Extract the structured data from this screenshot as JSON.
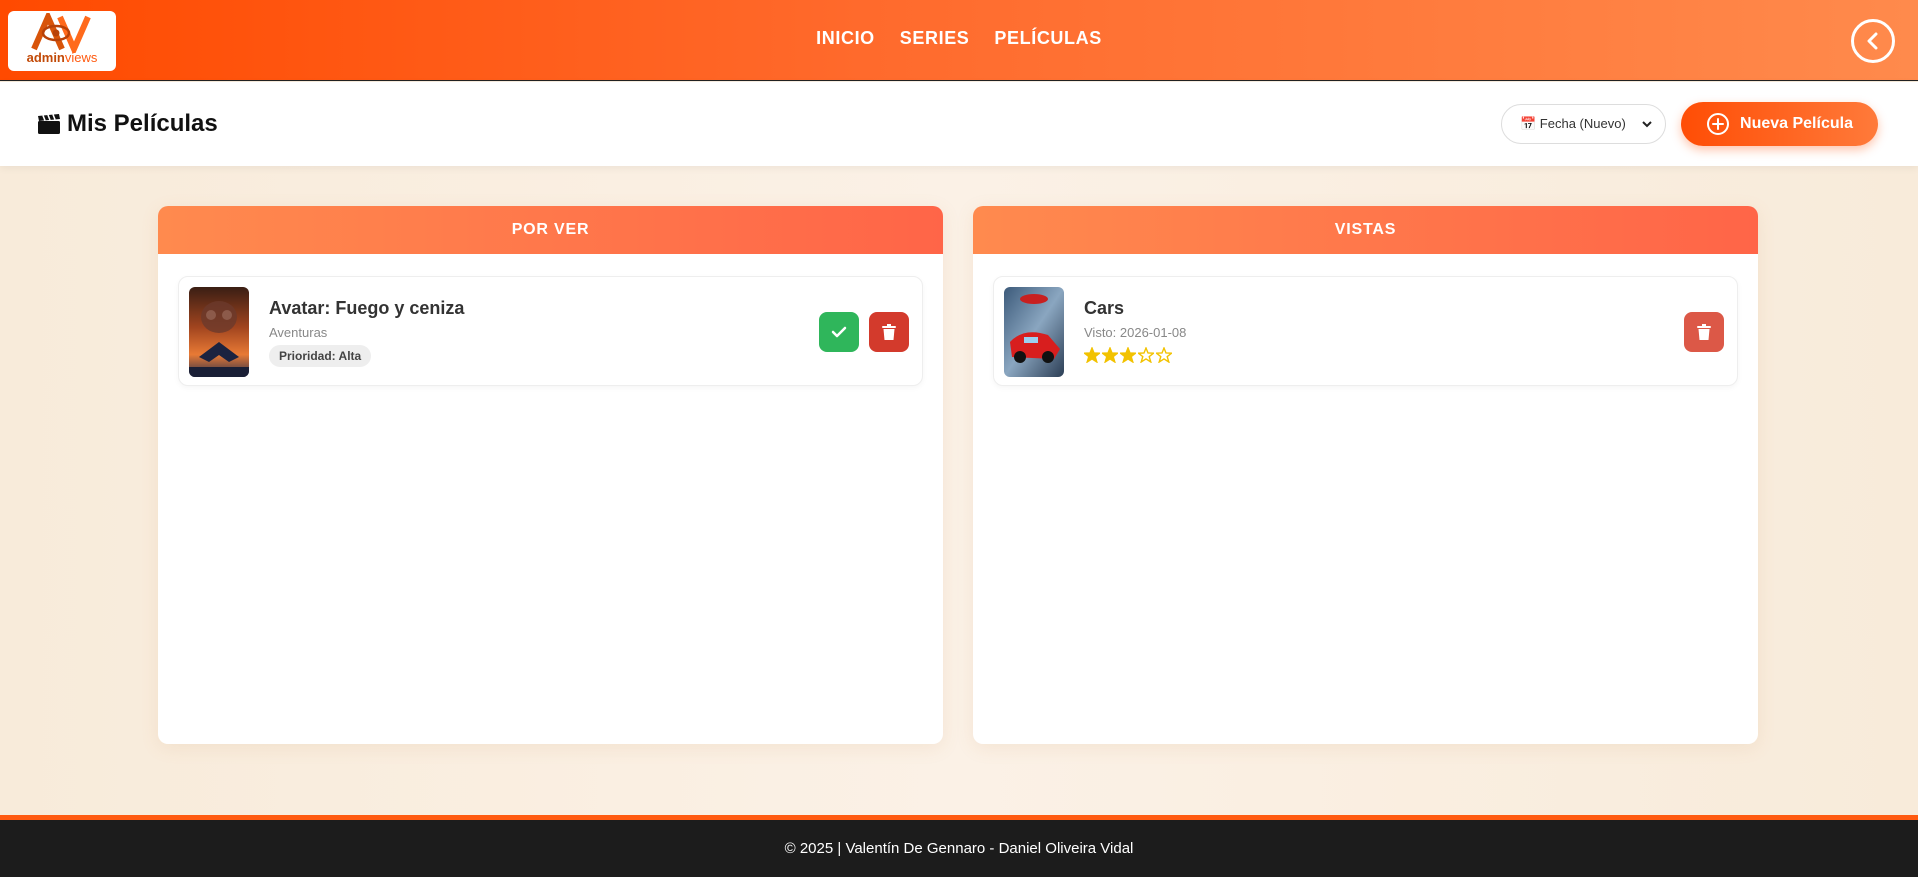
{
  "brand": {
    "logo_main": "admin",
    "logo_accent": "views"
  },
  "nav": {
    "items": [
      "INICIO",
      "SERIES",
      "PELÍCULAS"
    ]
  },
  "header": {
    "title": "Mis Películas",
    "sort_label": "📅 Fecha (Nuevo)",
    "new_button_label": "Nueva Película"
  },
  "columns": {
    "to_watch": {
      "title": "POR VER",
      "items": [
        {
          "title": "Avatar: Fuego y ceniza",
          "genre": "Aventuras",
          "priority": "Prioridad: Alta"
        }
      ]
    },
    "watched": {
      "title": "VISTAS",
      "items": [
        {
          "title": "Cars",
          "watched": "Visto: 2026-01-08",
          "rating": 3,
          "rating_max": 5
        }
      ]
    }
  },
  "footer": {
    "text": "© 2025 | Valentín De Gennaro - Daniel Oliveira Vidal"
  },
  "colors": {
    "accent": "#ff5a10",
    "success": "#2fb65b",
    "danger": "#d33a2c",
    "star": "#f2c200"
  }
}
